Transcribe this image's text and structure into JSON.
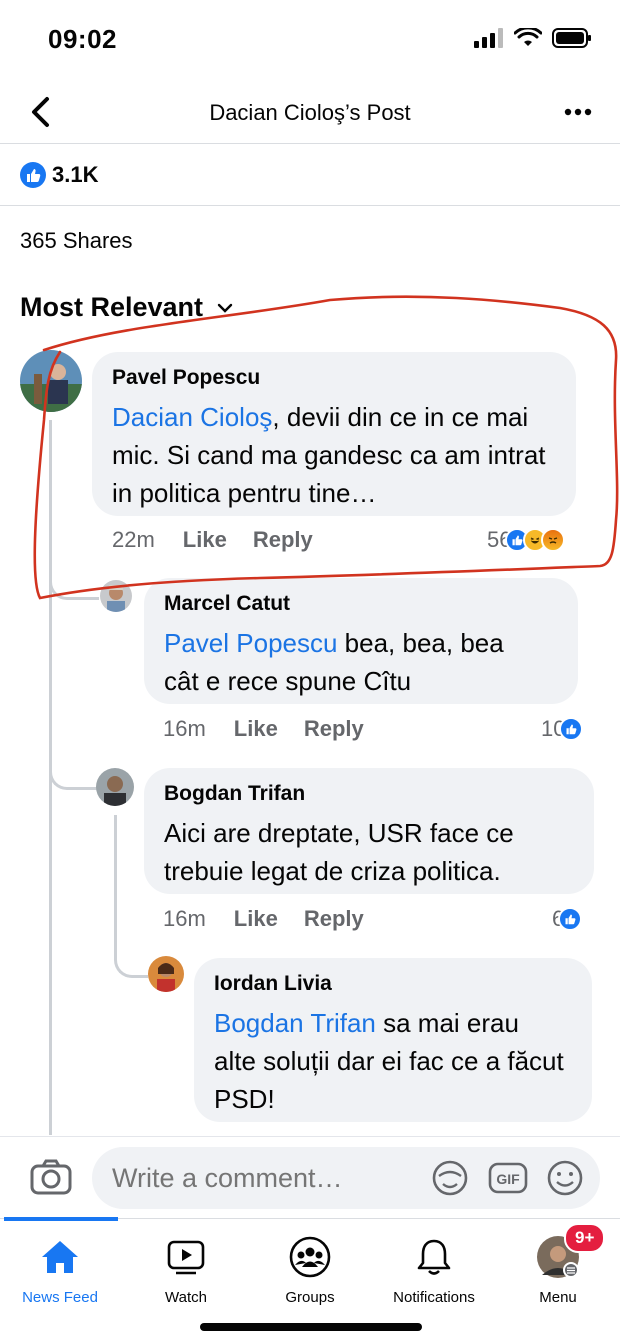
{
  "status": {
    "time": "09:02"
  },
  "header": {
    "title": "Dacian Cioloş’s Post"
  },
  "post": {
    "reaction_count": "3.1K",
    "shares": "365 Shares"
  },
  "sort": {
    "label": "Most Relevant"
  },
  "comments": [
    {
      "author": "Pavel Popescu",
      "mention": "Dacian Cioloş",
      "text_line1": ", devii din ce in ce",
      "text_rest": "mai mic. Si cand ma gandesc ca am intrat in politica pentru tine…",
      "age": "22m",
      "like": "Like",
      "reply": "Reply",
      "reactions": "56"
    },
    {
      "author": "Marcel Catut",
      "mention": "Pavel Popescu",
      "text_line1": " bea, bea, bea",
      "text_rest": "cât e rece spune Cîtu",
      "age": "16m",
      "like": "Like",
      "reply": "Reply",
      "reactions": "10"
    },
    {
      "author": "Bogdan Trifan",
      "text_line1": "Aici are dreptate, USR face ce",
      "text_rest": "trebuie legat de criza politica.",
      "age": "16m",
      "like": "Like",
      "reply": "Reply",
      "reactions": "6"
    },
    {
      "author": "Iordan Livia",
      "mention": "Bogdan Trifan",
      "text_line1": " sa mai erau",
      "text_rest": "alte soluții dar ei fac ce a făcut PSD!"
    }
  ],
  "composer": {
    "placeholder": "Write a comment…"
  },
  "tabs": [
    {
      "label": "News Feed"
    },
    {
      "label": "Watch"
    },
    {
      "label": "Groups"
    },
    {
      "label": "Notifications"
    },
    {
      "label": "Menu",
      "badge": "9+"
    }
  ],
  "colors": {
    "accent": "#1877f2",
    "mention": "#1b74e4",
    "annotation": "#d1331f",
    "badge": "#e41e3f"
  }
}
